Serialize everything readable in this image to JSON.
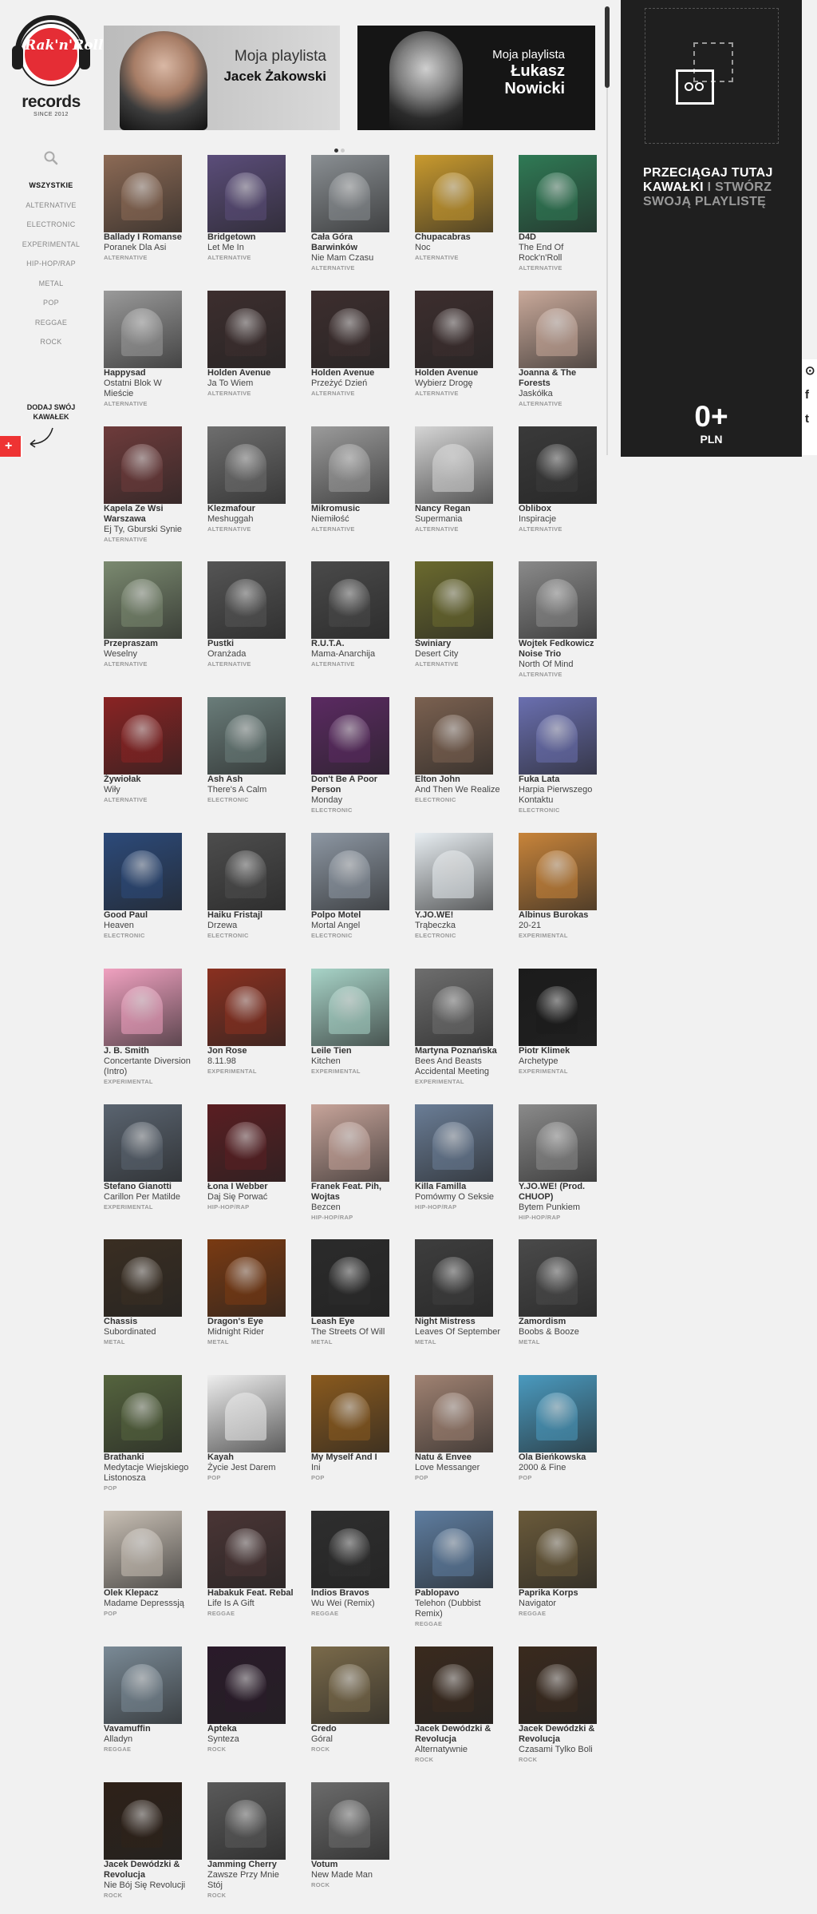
{
  "brand": {
    "logo_text": "Rak'n'Roll",
    "records": "records",
    "since": "SINCE 2012"
  },
  "nav": {
    "categories": [
      "WSZYSTKIE",
      "ALTERNATIVE",
      "ELECTRONIC",
      "EXPERIMENTAL",
      "HIP-HOP/RAP",
      "METAL",
      "POP",
      "REGGAE",
      "ROCK"
    ],
    "active": "WSZYSTKIE"
  },
  "add_track": "DODAJ SWÓJ KAWAŁEK",
  "banners": [
    {
      "kicker": "Moja playlista",
      "name": "Jacek Żakowski"
    },
    {
      "kicker": "Moja playlista",
      "name": "Łukasz Nowicki"
    }
  ],
  "playlist": {
    "drop_white": "PRZECIĄGAJ TUTAJ KAWAŁKI",
    "drop_gray": "I STWÓRZ SWOJĄ PLAYLISTĘ",
    "price": "0+",
    "currency": "PLN"
  },
  "colors": {
    "accent": "#e52d35",
    "panel": "#1f1f1f",
    "background": "#f1f1f1"
  },
  "tracks": [
    {
      "artist": "Ballady I Romanse",
      "title": "Poranek Dla Asi",
      "genre": "ALTERNATIVE",
      "bg": "#8c6a55"
    },
    {
      "artist": "Bridgetown",
      "title": "Let Me In",
      "genre": "ALTERNATIVE",
      "bg": "#5b4d7a"
    },
    {
      "artist": "Cała Góra Barwinków",
      "title": "Nie Mam Czasu",
      "genre": "ALTERNATIVE",
      "bg": "#8a8f93"
    },
    {
      "artist": "Chupacabras",
      "title": "Noc",
      "genre": "ALTERNATIVE",
      "bg": "#c99a2e"
    },
    {
      "artist": "D4D",
      "title": "The End Of Rock'n'Roll",
      "genre": "ALTERNATIVE",
      "bg": "#2f7a55"
    },
    {
      "artist": "Happysad",
      "title": "Ostatni Blok W Mieście",
      "genre": "ALTERNATIVE",
      "bg": "#9a9a9a"
    },
    {
      "artist": "Holden Avenue",
      "title": "Ja To Wiem",
      "genre": "ALTERNATIVE",
      "bg": "#3d2e2e"
    },
    {
      "artist": "Holden Avenue",
      "title": "Przeżyć Dzień",
      "genre": "ALTERNATIVE",
      "bg": "#3d2e2e"
    },
    {
      "artist": "Holden Avenue",
      "title": "Wybierz Drogę",
      "genre": "ALTERNATIVE",
      "bg": "#3d2e2e"
    },
    {
      "artist": "Joanna & The Forests",
      "title": "Jaskółka",
      "genre": "ALTERNATIVE",
      "bg": "#c9a99a"
    },
    {
      "artist": "Kapela Ze Wsi Warszawa",
      "title": "Ej Ty, Gburski Synie",
      "genre": "ALTERNATIVE",
      "bg": "#6e3b3b"
    },
    {
      "artist": "Klezmafour",
      "title": "Meshuggah",
      "genre": "ALTERNATIVE",
      "bg": "#6e6e6e"
    },
    {
      "artist": "Mikromusic",
      "title": "Niemiłość",
      "genre": "ALTERNATIVE",
      "bg": "#9b9b9b"
    },
    {
      "artist": "Nancy Regan",
      "title": "Supermania",
      "genre": "ALTERNATIVE",
      "bg": "#d5d5d5"
    },
    {
      "artist": "Oblibox",
      "title": "Inspiracje",
      "genre": "ALTERNATIVE",
      "bg": "#3a3a3a"
    },
    {
      "artist": "Przepraszam",
      "title": "Weselny",
      "genre": "ALTERNATIVE",
      "bg": "#7b8a70"
    },
    {
      "artist": "Pustki",
      "title": "Oranżada",
      "genre": "ALTERNATIVE",
      "bg": "#555555"
    },
    {
      "artist": "R.U.T.A.",
      "title": "Mama-Anarchija",
      "genre": "ALTERNATIVE",
      "bg": "#4a4a4a"
    },
    {
      "artist": "Świniary",
      "title": "Desert City",
      "genre": "ALTERNATIVE",
      "bg": "#6b6a2e"
    },
    {
      "artist": "Wojtek Fedkowicz Noise Trio",
      "title": "North Of Mind",
      "genre": "ALTERNATIVE",
      "bg": "#8a8a8a"
    },
    {
      "artist": "Żywiołak",
      "title": "Wiły",
      "genre": "ALTERNATIVE",
      "bg": "#8a2323"
    },
    {
      "artist": "Ash Ash",
      "title": "There's A Calm",
      "genre": "ELECTRONIC",
      "bg": "#6a7d7a"
    },
    {
      "artist": "Don't Be A Poor Person",
      "title": "Monday",
      "genre": "ELECTRONIC",
      "bg": "#5b2a62"
    },
    {
      "artist": "Elton John",
      "title": "And Then We Realize",
      "genre": "ELECTRONIC",
      "bg": "#7b6150"
    },
    {
      "artist": "Fuka Lata",
      "title": "Harpia Pierwszego Kontaktu",
      "genre": "ELECTRONIC",
      "bg": "#6a6fb0"
    },
    {
      "artist": "Good Paul",
      "title": "Heaven",
      "genre": "ELECTRONIC",
      "bg": "#2c4a7a"
    },
    {
      "artist": "Haiku Fristajl",
      "title": "Drzewa",
      "genre": "ELECTRONIC",
      "bg": "#4d4d4d"
    },
    {
      "artist": "Polpo Motel",
      "title": "Mortal Angel",
      "genre": "ELECTRONIC",
      "bg": "#8d97a3"
    },
    {
      "artist": "Y.JO.WE!",
      "title": "Trąbeczka",
      "genre": "ELECTRONIC",
      "bg": "#e8eef2"
    },
    {
      "artist": "Albinus Burokas",
      "title": "20-21",
      "genre": "EXPERIMENTAL",
      "bg": "#c8843a"
    },
    {
      "artist": "J. B. Smith",
      "title": "Concertante Diversion (Intro)",
      "genre": "EXPERIMENTAL",
      "bg": "#f0a1c0"
    },
    {
      "artist": "Jon Rose",
      "title": "8.11.98",
      "genre": "EXPERIMENTAL",
      "bg": "#8a3020"
    },
    {
      "artist": "Leile Tien",
      "title": "Kitchen",
      "genre": "EXPERIMENTAL",
      "bg": "#a8d4c8"
    },
    {
      "artist": "Martyna Poznańska",
      "title": "Bees And Beasts Accidental Meeting",
      "genre": "EXPERIMENTAL",
      "bg": "#6e6e6e"
    },
    {
      "artist": "Piotr Klimek",
      "title": "Archetype",
      "genre": "EXPERIMENTAL",
      "bg": "#1b1b1b"
    },
    {
      "artist": "Stefano Gianotti",
      "title": "Carillon Per Matilde",
      "genre": "EXPERIMENTAL",
      "bg": "#5a6470"
    },
    {
      "artist": "Łona I Webber",
      "title": "Daj Się Porwać",
      "genre": "HIP-HOP/RAP",
      "bg": "#5a1e22"
    },
    {
      "artist": "Franek Feat. Pih, Wojtas",
      "title": "Bezcen",
      "genre": "HIP-HOP/RAP",
      "bg": "#c7a49a"
    },
    {
      "artist": "Killa Familla",
      "title": "Pomówmy O Seksie",
      "genre": "HIP-HOP/RAP",
      "bg": "#6a7d96"
    },
    {
      "artist": "Y.JO.WE! (Prod. CHUOP)",
      "title": "Bytem Punkiem",
      "genre": "HIP-HOP/RAP",
      "bg": "#8a8a8a"
    },
    {
      "artist": "Chassis",
      "title": "Subordinated",
      "genre": "METAL",
      "bg": "#3a2e22"
    },
    {
      "artist": "Dragon's Eye",
      "title": "Midnight Rider",
      "genre": "METAL",
      "bg": "#7a3a12"
    },
    {
      "artist": "Leash Eye",
      "title": "The Streets Of Will",
      "genre": "METAL",
      "bg": "#2b2b2b"
    },
    {
      "artist": "Night Mistress",
      "title": "Leaves Of September",
      "genre": "METAL",
      "bg": "#3e3e3e"
    },
    {
      "artist": "Zamordism",
      "title": "Boobs & Booze",
      "genre": "METAL",
      "bg": "#4a4a4a"
    },
    {
      "artist": "Brathanki",
      "title": "Medytacje Wiejskiego Listonosza",
      "genre": "POP",
      "bg": "#55643e"
    },
    {
      "artist": "Kayah",
      "title": "Życie Jest Darem",
      "genre": "POP",
      "bg": "#eeeeee"
    },
    {
      "artist": "My Myself And I",
      "title": "Ini",
      "genre": "POP",
      "bg": "#8a5a1e"
    },
    {
      "artist": "Natu & Envee",
      "title": "Love Messanger",
      "genre": "POP",
      "bg": "#a08272"
    },
    {
      "artist": "Ola Bieńkowska",
      "title": "2000 & Fine",
      "genre": "POP",
      "bg": "#4a9abf"
    },
    {
      "artist": "Olek Klepacz",
      "title": "Madame Depresssją",
      "genre": "POP",
      "bg": "#c9c0b5"
    },
    {
      "artist": "Habakuk Feat. Rebal",
      "title": "Life Is A Gift",
      "genre": "REGGAE",
      "bg": "#4a3535"
    },
    {
      "artist": "Indios Bravos",
      "title": "Wu Wei (Remix)",
      "genre": "REGGAE",
      "bg": "#2e2e2e"
    },
    {
      "artist": "Pablopavo",
      "title": "Telehon (Dubbist Remix)",
      "genre": "REGGAE",
      "bg": "#5e7da0"
    },
    {
      "artist": "Paprika Korps",
      "title": "Navigator",
      "genre": "REGGAE",
      "bg": "#6a5a3a"
    },
    {
      "artist": "Vavamuffin",
      "title": "Alladyn",
      "genre": "REGGAE",
      "bg": "#7a8a96"
    },
    {
      "artist": "Apteka",
      "title": "Synteza",
      "genre": "ROCK",
      "bg": "#2a1a2a"
    },
    {
      "artist": "Credo",
      "title": "Góral",
      "genre": "ROCK",
      "bg": "#7a6a4a"
    },
    {
      "artist": "Jacek Dewódzki & Revolucja",
      "title": "Alternatywnie",
      "genre": "ROCK",
      "bg": "#3a2a1e"
    },
    {
      "artist": "Jacek Dewódzki & Revolucja",
      "title": "Czasami Tylko Boli",
      "genre": "ROCK",
      "bg": "#3a2a1e"
    },
    {
      "artist": "Jacek Dewódzki & Revolucja",
      "title": "Nie Bój Się Revolucji",
      "genre": "ROCK",
      "bg": "#2e2118"
    },
    {
      "artist": "Jamming Cherry",
      "title": "Zawsze Przy Mnie Stój",
      "genre": "ROCK",
      "bg": "#5a5a5a"
    },
    {
      "artist": "Votum",
      "title": "New Made Man",
      "genre": "ROCK",
      "bg": "#6b6b6b"
    }
  ]
}
